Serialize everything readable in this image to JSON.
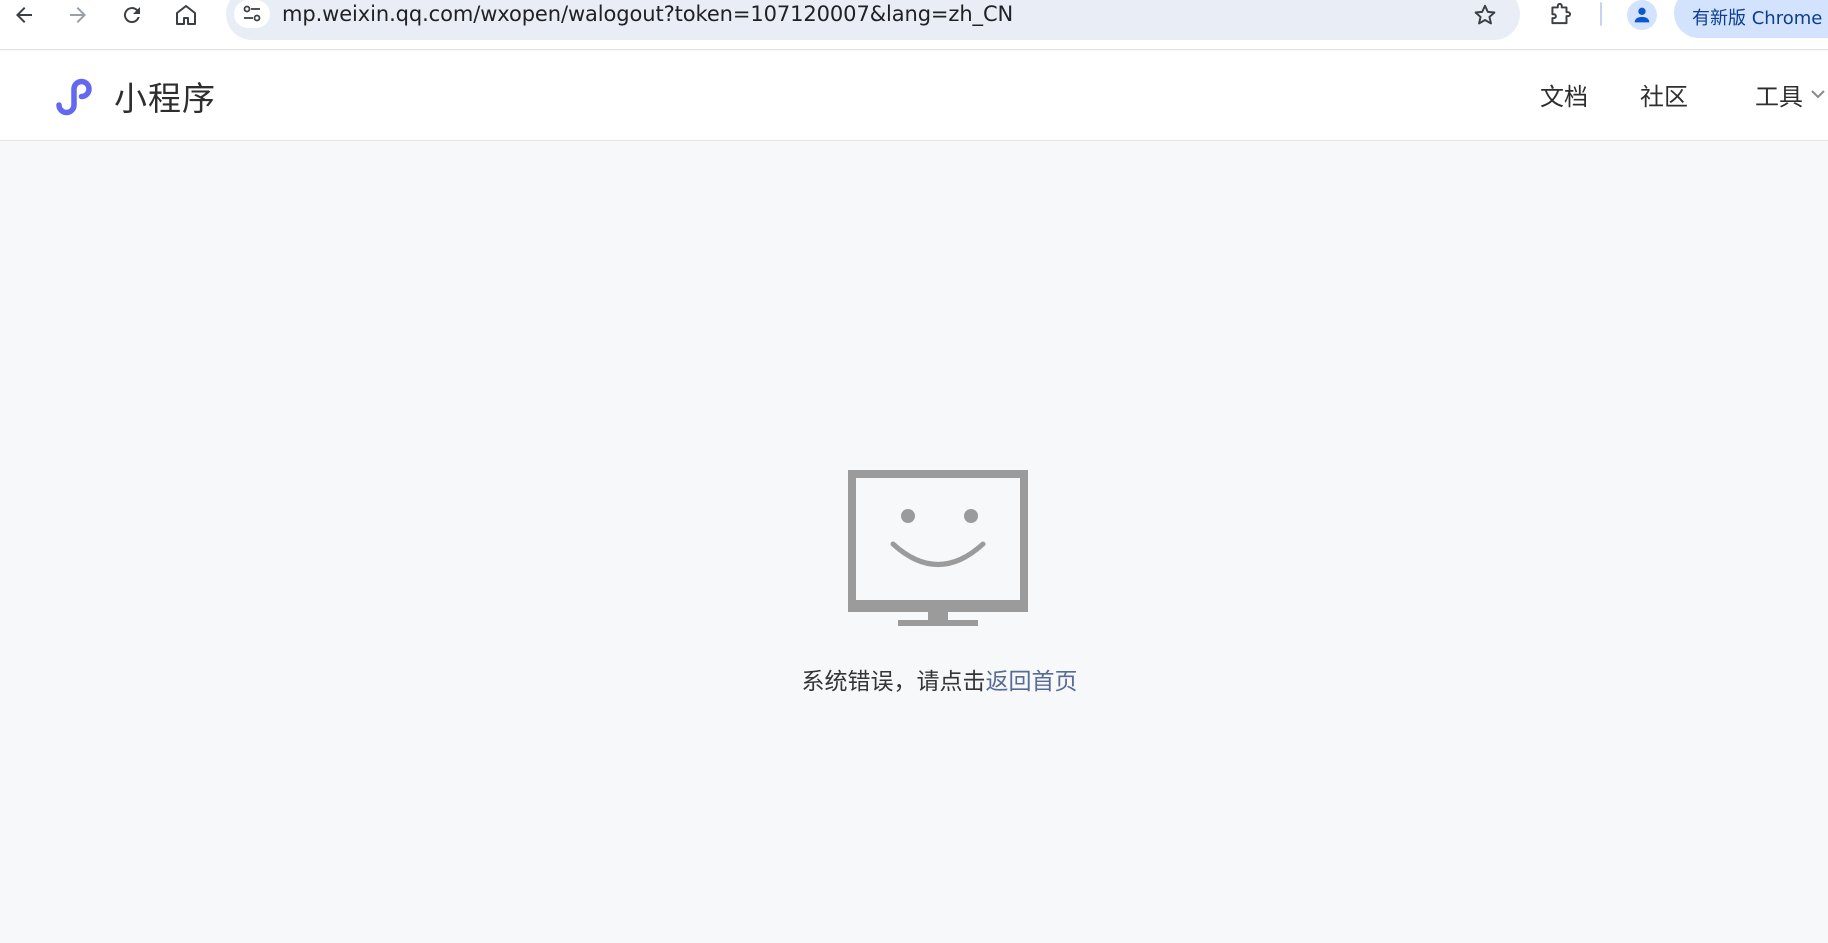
{
  "browser": {
    "url": "mp.weixin.qq.com/wxopen/walogout?token=107120007&lang=zh_CN",
    "update_label": "有新版 Chrome 可用"
  },
  "header": {
    "logo_text": "小程序",
    "nav": {
      "docs": "文档",
      "community": "社区",
      "tools": "工具"
    }
  },
  "error": {
    "message": "系统错误，请点击",
    "link_text": "返回首页"
  },
  "colors": {
    "brand": "#6467f0",
    "link": "#576b95",
    "monitor": "#9b9b9b",
    "background": "#f7f8fa"
  }
}
